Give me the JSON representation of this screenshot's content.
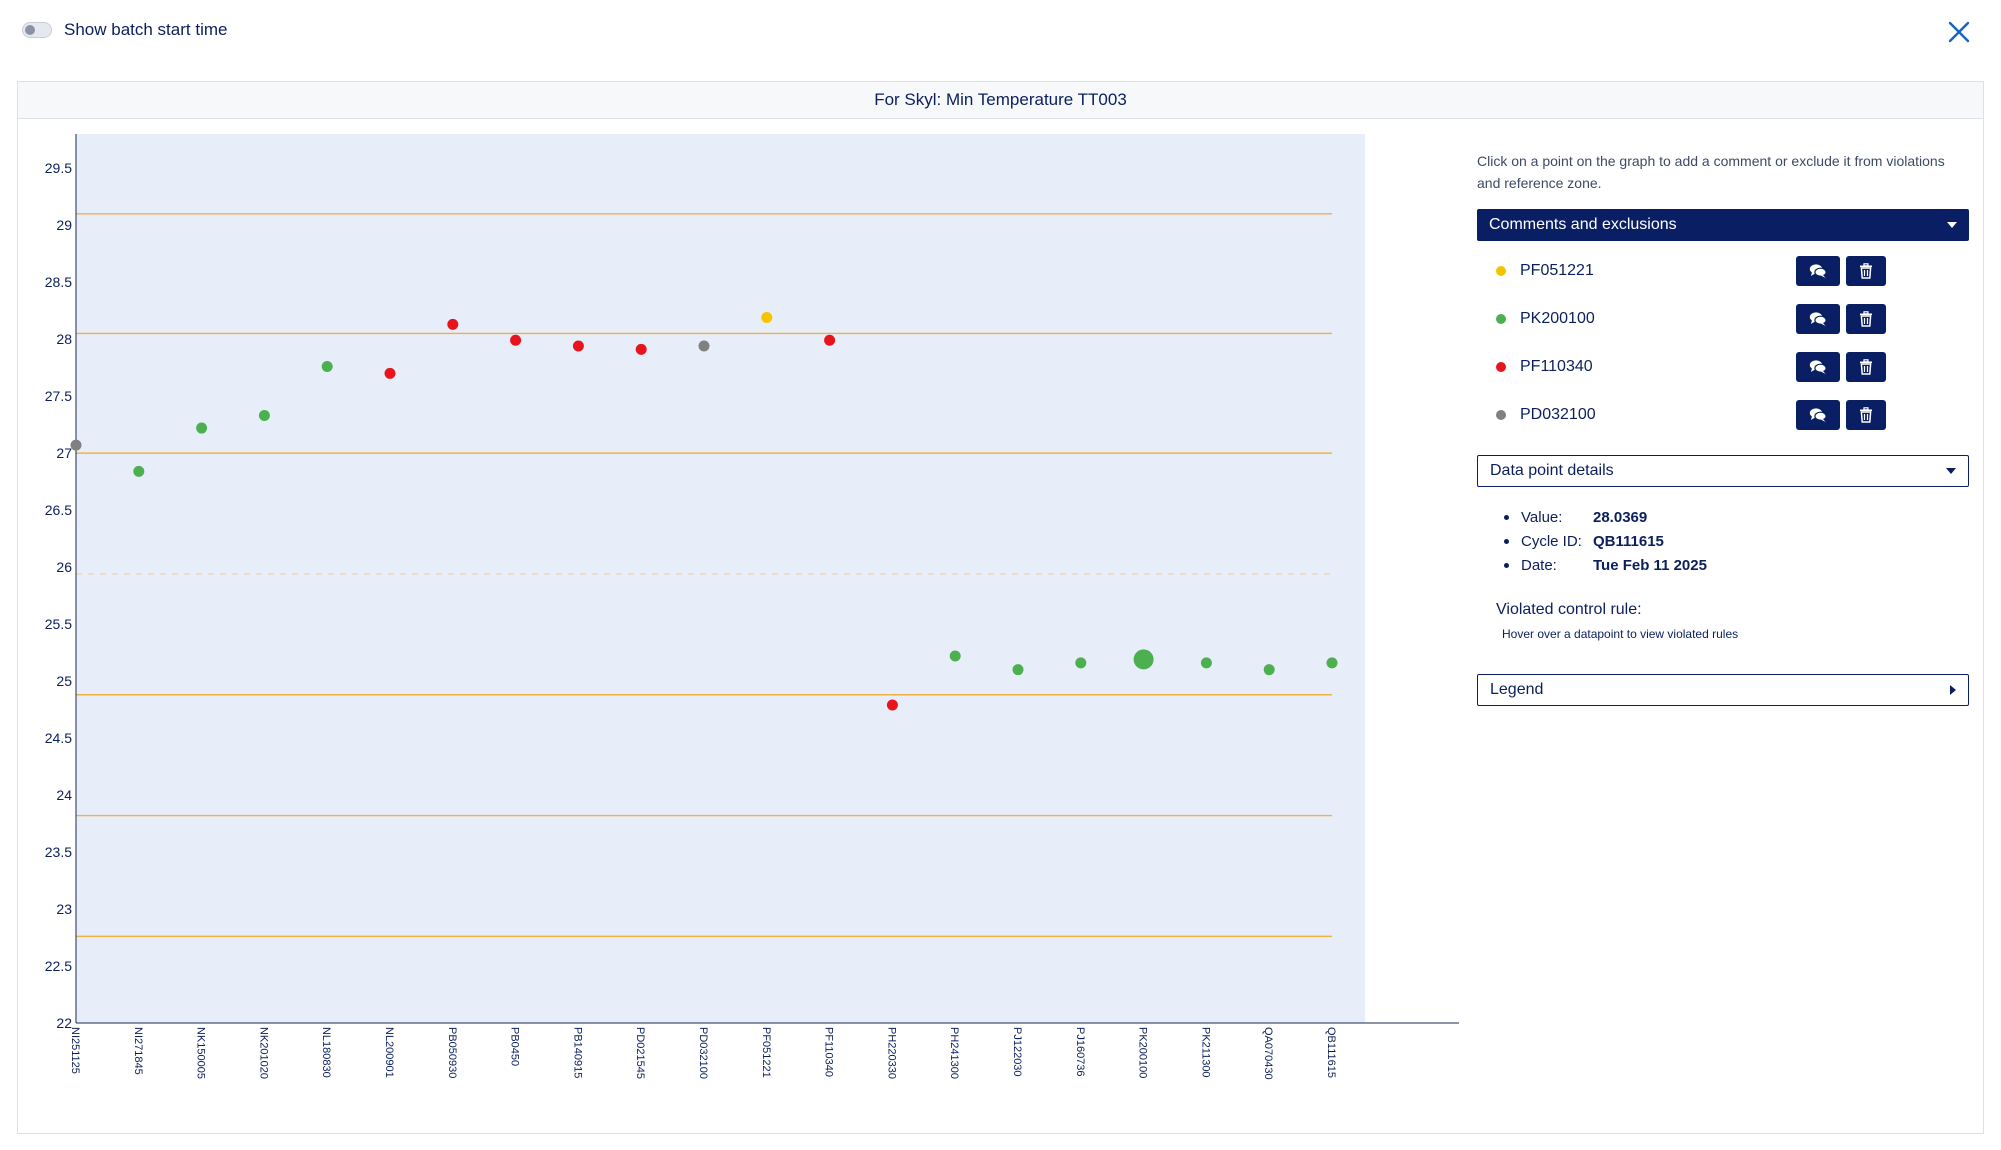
{
  "toggle": {
    "label": "Show batch start time",
    "on": false
  },
  "panel": {
    "title": "For Skyl: Min Temperature TT003"
  },
  "sidebar": {
    "hint": "Click on a point on the graph to add a comment or exclude it from violations and reference zone.",
    "comments_header": "Comments and exclusions",
    "comments": [
      {
        "label": "PF051221",
        "color": "#f5c400"
      },
      {
        "label": "PK200100",
        "color": "#4caf50"
      },
      {
        "label": "PF110340",
        "color": "#e8141b"
      },
      {
        "label": "PD032100",
        "color": "#808080"
      }
    ],
    "details_header": "Data point details",
    "details": [
      {
        "key": "Value:",
        "value": "28.0369"
      },
      {
        "key": "Cycle ID:",
        "value": "QB111615"
      },
      {
        "key": "Date:",
        "value": "Tue Feb 11 2025"
      }
    ],
    "violated_title": "Violated control rule:",
    "violated_hint": "Hover over a datapoint to view violated rules",
    "legend_header": "Legend"
  },
  "colors": {
    "navy": "#0a1f63",
    "plot_bg": "#e8eef9",
    "limit": "#f5a623",
    "green": "#4caf50",
    "red": "#e8141b",
    "yellow": "#f5c400",
    "grey": "#808080"
  },
  "chart_data": {
    "type": "scatter",
    "categories": [
      "NI251125",
      "NI271845",
      "NK150005",
      "NK201020",
      "NL180830",
      "NL200901",
      "PB050930",
      "PB0450",
      "PB140915",
      "PD021545",
      "PD032100",
      "PF051221",
      "PF110340",
      "PH220330",
      "PH241300",
      "PJ122030",
      "PJ160736",
      "PK200100",
      "PK211300",
      "QA070430",
      "QB111615"
    ],
    "values": [
      27.07,
      26.84,
      27.22,
      27.33,
      27.76,
      27.7,
      28.13,
      27.99,
      27.94,
      27.91,
      27.94,
      28.19,
      27.99,
      24.79,
      25.22,
      25.1,
      25.16,
      25.19,
      25.16,
      25.1,
      25.16
    ],
    "point_colors": [
      "grey",
      "green",
      "green",
      "green",
      "green",
      "red",
      "red",
      "red",
      "red",
      "red",
      "grey",
      "yellow",
      "red",
      "red",
      "green",
      "green",
      "green",
      "green",
      "green",
      "green",
      "green"
    ],
    "highlighted_index": 17,
    "ylim": [
      22,
      29.8
    ],
    "yticks": [
      22,
      22.5,
      23,
      23.5,
      24,
      24.5,
      25,
      25.5,
      26,
      26.5,
      27,
      27.5,
      28,
      28.5,
      29,
      29.5
    ],
    "limit_lines": [
      29.1,
      28.05,
      27.0,
      24.88,
      23.82,
      22.76
    ],
    "center_line": 25.94
  }
}
